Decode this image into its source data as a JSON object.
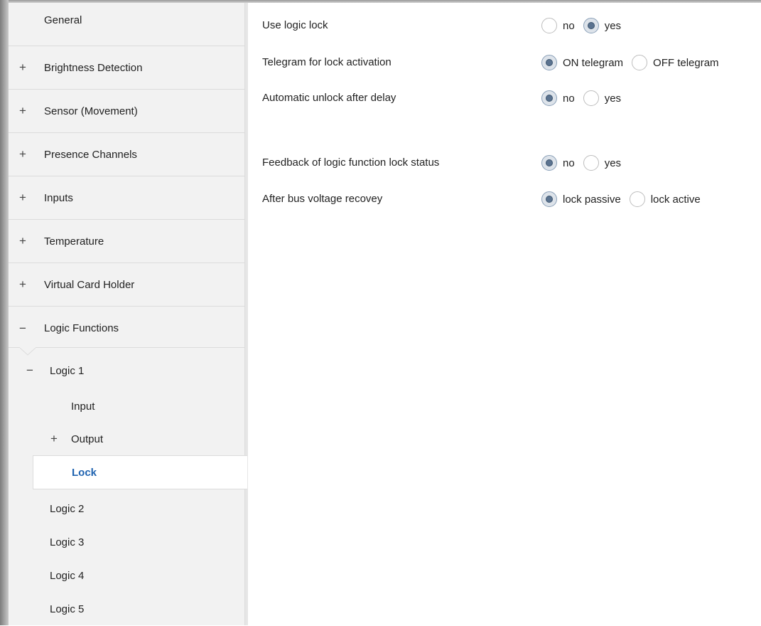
{
  "sidebar": {
    "top_items": [
      {
        "sign": "",
        "label": "General"
      },
      {
        "sign": "+",
        "label": "Brightness Detection"
      },
      {
        "sign": "+",
        "label": "Sensor (Movement)"
      },
      {
        "sign": "+",
        "label": "Presence Channels"
      },
      {
        "sign": "+",
        "label": "Inputs"
      },
      {
        "sign": "+",
        "label": "Temperature"
      },
      {
        "sign": "+",
        "label": "Virtual Card Holder"
      },
      {
        "sign": "−",
        "label": "Logic Functions"
      }
    ],
    "logic1": {
      "sign": "−",
      "label": "Logic 1"
    },
    "input": {
      "label": "Input"
    },
    "output": {
      "sign": "+",
      "label": "Output"
    },
    "lock": {
      "label": "Lock"
    },
    "logic_items": [
      {
        "label": "Logic 2"
      },
      {
        "label": "Logic 3"
      },
      {
        "label": "Logic 4"
      },
      {
        "label": "Logic 5"
      }
    ]
  },
  "params": [
    {
      "label": "Use logic lock",
      "options": [
        "no",
        "yes"
      ],
      "selected": "yes"
    },
    {
      "label": "Telegram for lock activation",
      "options": [
        "ON telegram",
        "OFF telegram"
      ],
      "selected": "ON telegram"
    },
    {
      "label": "Automatic unlock after delay",
      "options": [
        "no",
        "yes"
      ],
      "selected": "no"
    },
    {
      "label": "Feedback of logic function lock status",
      "options": [
        "no",
        "yes"
      ],
      "selected": "no"
    },
    {
      "label": "After bus voltage recovey",
      "options": [
        "lock passive",
        "lock active"
      ],
      "selected": "lock passive"
    }
  ],
  "colors": {
    "selected_text": "#1f63b0",
    "sidebar_bg": "#f2f2f2"
  }
}
